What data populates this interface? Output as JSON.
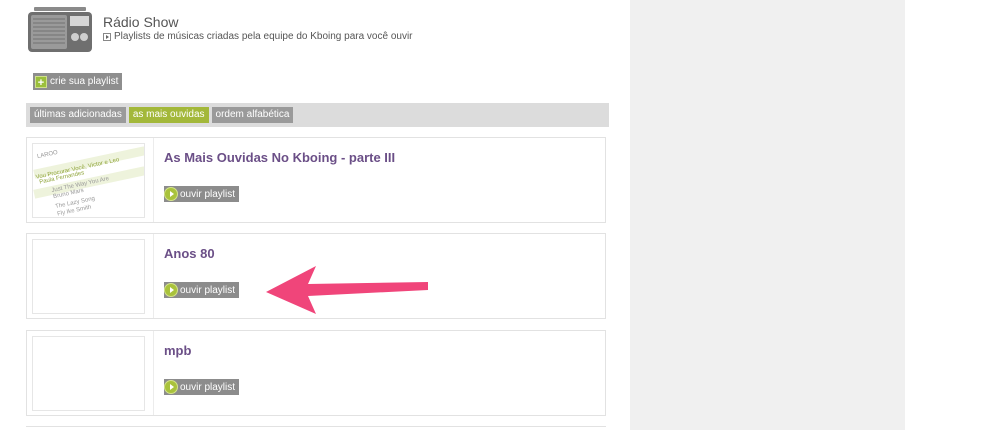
{
  "header": {
    "title": "Rádio Show",
    "subtitle": "Playlists de músicas criadas pela equipe do Kboing para você ouvir"
  },
  "create_button": {
    "label": "crie sua playlist"
  },
  "tabs": [
    {
      "label": "últimas adicionadas",
      "active": false
    },
    {
      "label": "as mais ouvidas",
      "active": true
    },
    {
      "label": "ordem alfabética",
      "active": false
    }
  ],
  "playlists": [
    {
      "title": "As Mais Ouvidas No Kboing - parte III",
      "button_label": "ouvir playlist",
      "has_thumbnail": true
    },
    {
      "title": "Anos 80",
      "button_label": "ouvir playlist",
      "has_thumbnail": false
    },
    {
      "title": "mpb",
      "button_label": "ouvir playlist",
      "has_thumbnail": false
    }
  ],
  "thumbnail_text": {
    "line1": "LAROO",
    "line2": "Vou Procurar Você, Victor e Leo",
    "line3": "Paula Fernandes",
    "line4": "Just The Way You Are",
    "line5": "Bruno Mars",
    "line6": "The Lazy Song",
    "line7": "Fly",
    "line8": "Fly Ike Smith"
  },
  "colors": {
    "accent_green": "#a3b83a",
    "title_purple": "#6b4f87",
    "annotation_arrow": "#f0457a",
    "panel_gray": "#f0f0f0"
  },
  "icons": {
    "header": "radio-icon",
    "create": "plus-icon",
    "listen": "play-circle-icon",
    "annotation": "arrow-left-icon"
  }
}
